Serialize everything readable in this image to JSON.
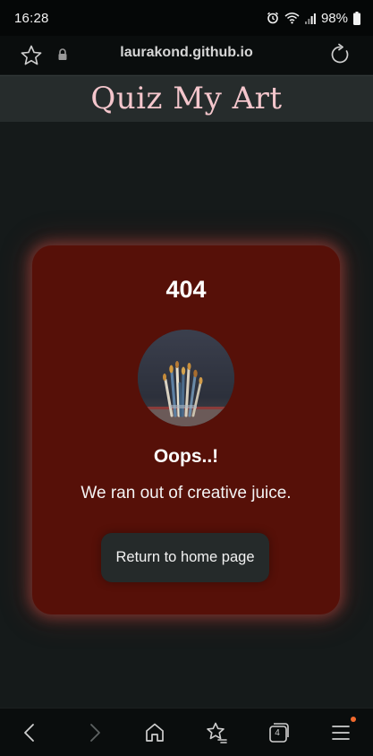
{
  "status_bar": {
    "time": "16:28",
    "battery": "98%"
  },
  "address_bar": {
    "url": "laurakond.github.io"
  },
  "header": {
    "title": "Quiz My Art"
  },
  "error_card": {
    "code": "404",
    "heading": "Oops..!",
    "message": "We ran out of creative juice.",
    "button_label": "Return to home page"
  },
  "bottom_nav": {
    "tab_count": "4"
  },
  "colors": {
    "title_pink": "#f4c6cc",
    "card_red": "#561008",
    "page_bg": "#151a1a",
    "notification_dot": "#f26a2e"
  },
  "icons": [
    "alarm-icon",
    "wifi-icon",
    "signal-icon",
    "battery-icon",
    "star-icon",
    "lock-icon",
    "reload-icon",
    "back-icon",
    "forward-icon",
    "home-icon",
    "bookmarks-icon",
    "tabs-icon",
    "menu-icon"
  ]
}
